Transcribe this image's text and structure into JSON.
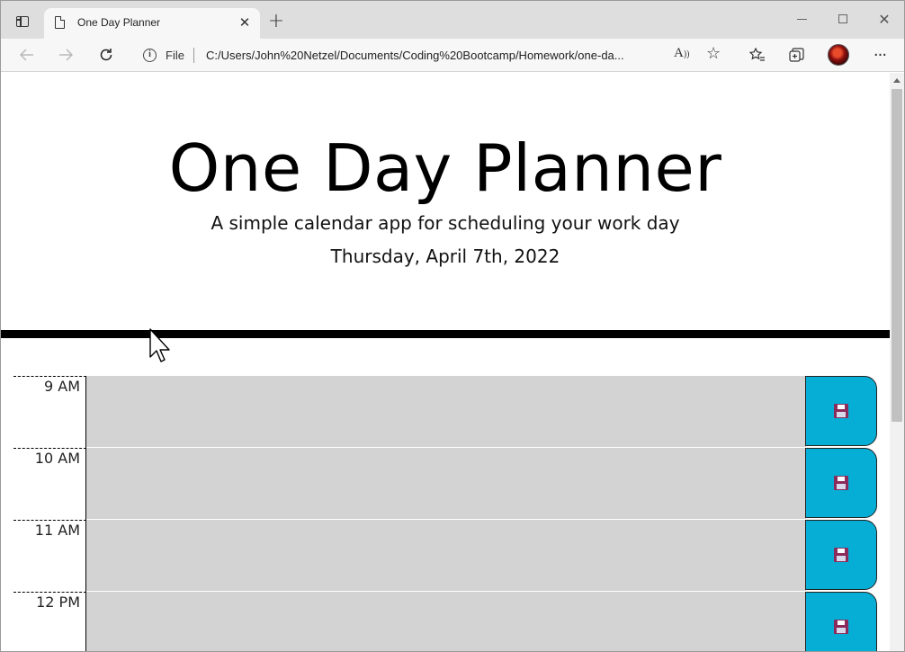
{
  "browser": {
    "tab_title": "One Day Planner",
    "tab_close": "✕",
    "new_tab": "+",
    "win_close": "✕",
    "scheme_label": "File",
    "url": "C:/Users/John%20Netzel/Documents/Coding%20Bootcamp/Homework/one-da...",
    "more": "···"
  },
  "header": {
    "title": "One Day Planner",
    "subtitle": "A simple calendar app for scheduling your work day",
    "date": "Thursday, April 7th, 2022"
  },
  "planner": {
    "rows": [
      {
        "hour": "9 AM"
      },
      {
        "hour": "10 AM"
      },
      {
        "hour": "11 AM"
      },
      {
        "hour": "12 PM"
      }
    ]
  },
  "colors": {
    "save_button": "#06aed5",
    "past_block": "#d3d3d3",
    "divider": "#000000"
  }
}
